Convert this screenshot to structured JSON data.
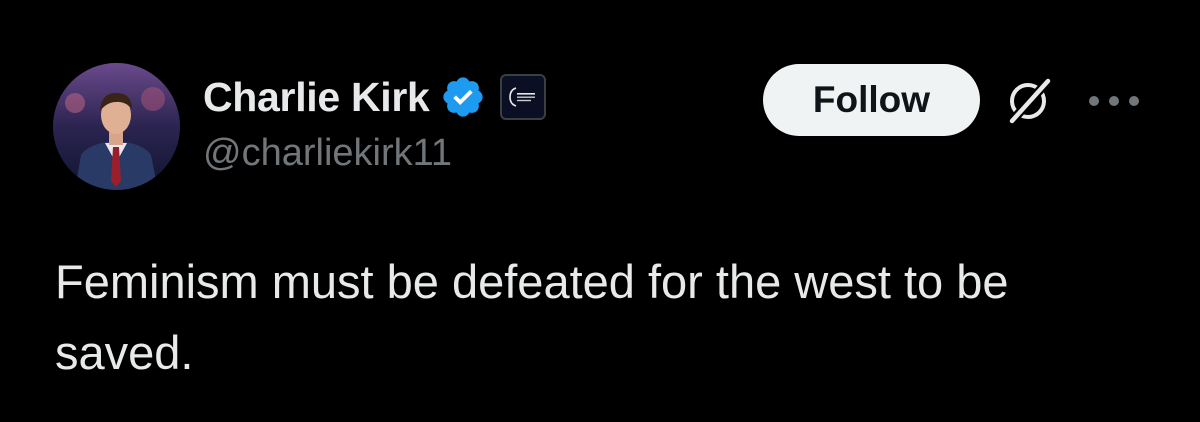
{
  "author": {
    "display_name": "Charlie Kirk",
    "handle": "@charliekirk11",
    "verified_color": "#1d9bf0",
    "avatar_icon": "profile-photo"
  },
  "actions": {
    "follow_label": "Follow",
    "grok_icon": "grok-icon",
    "more_icon": "more-dots-icon"
  },
  "tweet": {
    "text": "Feminism must be defeated for the west to be saved."
  },
  "colors": {
    "background": "#000000",
    "text_primary": "#e7e9ea",
    "text_secondary": "#71767b",
    "button_bg": "#eff3f4",
    "button_text": "#0f1419"
  }
}
